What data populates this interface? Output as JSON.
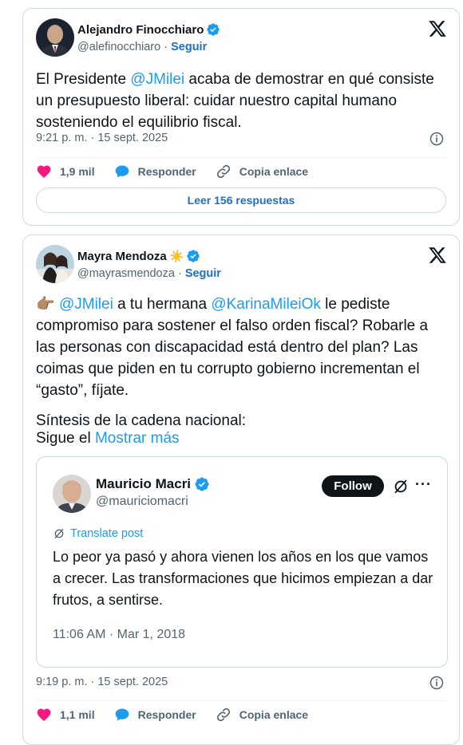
{
  "tweet1": {
    "author_name": "Alejandro Finocchiaro",
    "handle": "@alefinocchiaro",
    "separator": "·",
    "follow_label": "Seguir",
    "text_before": "El Presidente ",
    "mention": "@JMilei",
    "text_after": " acaba de demostrar en qué consiste un presupuesto liberal: cuidar nuestro capital humano sosteniendo el equilibrio fiscal.",
    "timestamp": "9:21 p. m. · 15 sept. 2025",
    "likes": "1,9 mil",
    "reply_label": "Responder",
    "copy_label": "Copia enlace",
    "read_replies": "Leer 156 respuestas"
  },
  "tweet2": {
    "author_name": "Mayra Mendoza",
    "name_emoji": "☀️",
    "handle": "@mayrasmendoza",
    "separator": "·",
    "follow_label": "Seguir",
    "emoji_lead": "👉🏽",
    "mention1": "@JMilei",
    "text1": " a tu hermana ",
    "mention2": "@KarinaMileiOk",
    "text2": " le pediste compromiso para sostener el falso orden fiscal? Robarle a las personas con discapacidad está dentro del plan? Las coimas que piden en tu corrupto gobierno incrementan el “gasto”, fíjate.",
    "paragraph2": "Síntesis de la cadena nacional:",
    "paragraph3_prefix": "Sigue el ",
    "show_more": "Mostrar más",
    "timestamp": "9:19 p. m. · 15 sept. 2025",
    "likes": "1,1 mil",
    "reply_label": "Responder",
    "copy_label": "Copia enlace"
  },
  "quote": {
    "author_name": "Mauricio Macri",
    "handle": "@mauriciomacri",
    "follow_label": "Follow",
    "more_label": "···",
    "translate_label": "Translate post",
    "text": "Lo peor ya pasó y ahora vienen los años en los que vamos a crecer. Las transformaciones que hicimos empiezan a dar frutos, a sentirse.",
    "timestamp": "11:06 AM · Mar 1, 2018"
  },
  "colors": {
    "accent_blue": "#1d9bf0",
    "link_blue": "#1d70c7",
    "heart_pink": "#f91880",
    "muted_gray": "#536471",
    "border": "#cfd9de"
  },
  "icons": [
    "verified-badge-icon",
    "x-logo-icon",
    "info-icon",
    "heart-icon",
    "reply-bubble-icon",
    "link-icon",
    "grok-icon",
    "translate-icon",
    "more-icon"
  ]
}
